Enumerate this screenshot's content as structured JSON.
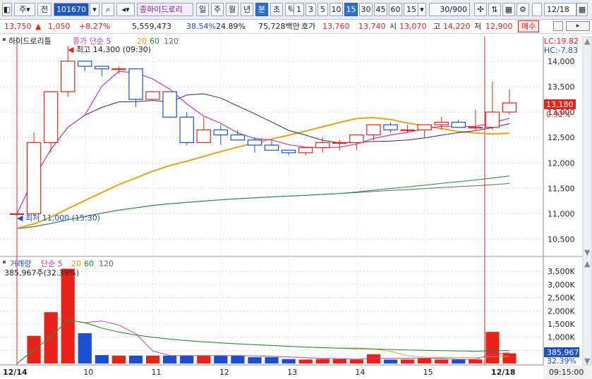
{
  "toolbar": {
    "type_label": "주",
    "prev_label": "전",
    "code_value": "101670",
    "stock_name": "하이드로리",
    "period_buttons": [
      "일",
      "주",
      "월",
      "년",
      "분",
      "초",
      "틱"
    ],
    "selected_period": "분",
    "minute_buttons": [
      "1",
      "3",
      "5",
      "10",
      "15",
      "30",
      "45",
      "60"
    ],
    "selected_minute": "15",
    "minute_select": "15",
    "count_value": "30/900",
    "date_value": "12/18"
  },
  "info": {
    "price": "13,750",
    "change": "1,050",
    "change_pct": "+8.27%",
    "volume": "5,559,473",
    "vol_ratio": "38.54%",
    "turnover": "24.89%",
    "amount": "75,728백만",
    "quote_label": "호가",
    "ask": "13,760",
    "bid": "13,740",
    "open_label": "시",
    "open": "13,070",
    "high_label": "고",
    "high": "14,220",
    "low_label": "저",
    "low": "12,900",
    "order_button": "매수"
  },
  "price_panel": {
    "legend_name": "하이드로리틀",
    "legend_sma": "종가 단순",
    "legend_periods": [
      "5",
      "20",
      "60",
      "120"
    ],
    "lc_label": "LC:19.82",
    "hc_label": "HC:-7.83",
    "high_marker": "최고 14,300 (09:30)",
    "low_marker": "최저 11,000 (15:30)",
    "current_price": "13,180",
    "current_pct": "0.92%",
    "y_ticks": [
      "14,000",
      "13,500",
      "13,000",
      "12,500",
      "12,000",
      "11,500",
      "11,000",
      "10,500"
    ]
  },
  "volume_panel": {
    "legend_name": "거래량",
    "legend_sma": "단순",
    "legend_periods": [
      "5",
      "20",
      "60",
      "120"
    ],
    "sub_label": "385,967주(32.39%)",
    "current_volume": "385,967",
    "current_pct": "32.39%",
    "y_ticks": [
      "3,500K",
      "3,000K",
      "2,500K",
      "2,000K",
      "1,500K",
      "1,000K",
      "500K"
    ]
  },
  "x_axis": {
    "ticks": [
      "12/14",
      "10",
      "11",
      "12",
      "13",
      "14",
      "15",
      "12/18"
    ],
    "time_label": "09:15:00"
  },
  "colors": {
    "up": "#e8231a",
    "down": "#1a4fd1",
    "ma5": "#c23bb8",
    "ma20": "#e8a413",
    "ma60": "#1a8a3a",
    "ma120": "#666666"
  },
  "chart_data": {
    "type": "candlestick",
    "x": [
      "12/14 15:30",
      "12/18 09:00",
      "09:15",
      "09:30",
      "09:45",
      "10:00",
      "10:15",
      "10:30",
      "10:45",
      "11:00",
      "11:15",
      "11:30",
      "11:45",
      "12:00",
      "12:15",
      "12:30",
      "12:45",
      "13:00",
      "13:15",
      "13:30",
      "13:45",
      "14:00",
      "14:15",
      "14:30",
      "14:45",
      "15:00",
      "15:15",
      "15:30",
      "12/18 09:00",
      "09:15"
    ],
    "open": [
      11000,
      11000,
      12400,
      13400,
      14000,
      13900,
      13850,
      13850,
      13250,
      13400,
      12900,
      12400,
      12650,
      12550,
      12450,
      12350,
      12250,
      12200,
      12300,
      12400,
      12400,
      12550,
      12750,
      12650,
      12650,
      12750,
      12800,
      12700,
      12700,
      13000
    ],
    "high": [
      11050,
      12600,
      13350,
      14300,
      14000,
      13900,
      13900,
      13850,
      13400,
      13400,
      13000,
      12900,
      12750,
      12650,
      12500,
      12450,
      12250,
      12300,
      12500,
      12450,
      12500,
      12550,
      12800,
      12750,
      12700,
      12900,
      12850,
      13050,
      13600,
      13450
    ],
    "low": [
      10950,
      10950,
      12200,
      13300,
      13800,
      13700,
      13750,
      13100,
      13250,
      13100,
      12350,
      12400,
      12350,
      12450,
      12200,
      12300,
      12150,
      12150,
      12200,
      12250,
      12250,
      12450,
      12600,
      12600,
      12500,
      12650,
      12700,
      12650,
      12650,
      12950
    ],
    "close": [
      11000,
      12400,
      13400,
      14000,
      13900,
      13850,
      13850,
      13250,
      13400,
      12900,
      12400,
      12650,
      12550,
      12450,
      12350,
      12250,
      12200,
      12300,
      12400,
      12400,
      12550,
      12750,
      12650,
      12650,
      12750,
      12800,
      12700,
      12700,
      13000,
      13180
    ],
    "volume": [
      0,
      1050,
      1950,
      3600,
      1150,
      320,
      300,
      300,
      300,
      300,
      300,
      300,
      300,
      300,
      240,
      240,
      170,
      150,
      170,
      170,
      150,
      350,
      150,
      150,
      200,
      150,
      150,
      150,
      1200,
      386
    ],
    "price_ylim": [
      10300,
      14400
    ],
    "volume_ylim": [
      0,
      3800
    ],
    "volume_unit": "K"
  }
}
